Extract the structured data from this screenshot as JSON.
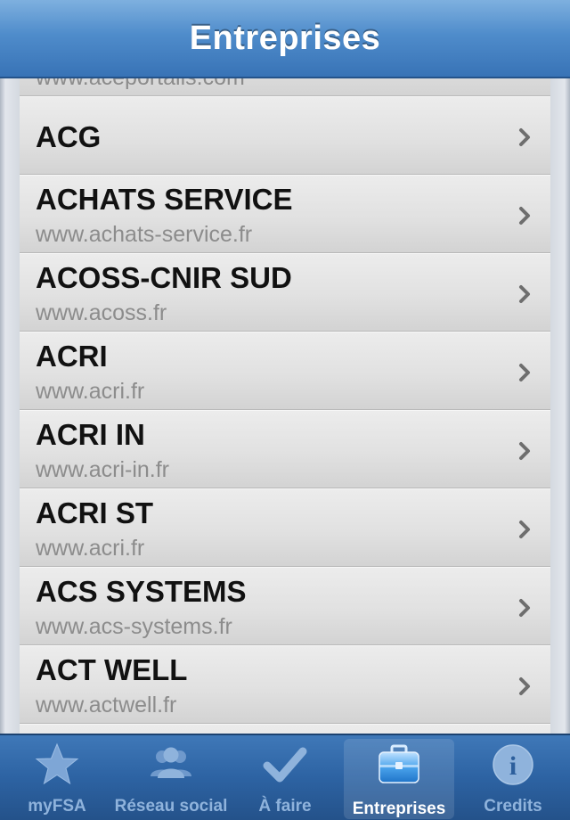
{
  "navbar": {
    "title": "Entreprises"
  },
  "list": {
    "items": [
      {
        "name": "",
        "url": "www.aceportails.com"
      },
      {
        "name": "ACG",
        "url": ""
      },
      {
        "name": "ACHATS SERVICE",
        "url": "www.achats-service.fr"
      },
      {
        "name": "ACOSS-CNIR SUD",
        "url": "www.acoss.fr"
      },
      {
        "name": "ACRI",
        "url": "www.acri.fr"
      },
      {
        "name": "ACRI IN",
        "url": "www.acri-in.fr"
      },
      {
        "name": "ACRI ST",
        "url": "www.acri.fr"
      },
      {
        "name": "ACS SYSTEMS",
        "url": "www.acs-systems.fr"
      },
      {
        "name": "ACT WELL",
        "url": "www.actwell.fr"
      },
      {
        "name": "",
        "url": ""
      }
    ]
  },
  "tabbar": {
    "tabs": [
      {
        "label": "myFSA",
        "icon": "star-icon",
        "active": false
      },
      {
        "label": "Réseau social",
        "icon": "people-icon",
        "active": false
      },
      {
        "label": "À faire",
        "icon": "checkmark-icon",
        "active": false
      },
      {
        "label": "Entreprises",
        "icon": "briefcase-icon",
        "active": true
      },
      {
        "label": "Credits",
        "icon": "info-icon",
        "active": false
      }
    ]
  },
  "colors": {
    "bar_blue": "#3873b6",
    "active_tab_label": "#ffffff",
    "inactive_tab_label": "#8fb3dc",
    "url_gray": "#8c8c8c"
  }
}
